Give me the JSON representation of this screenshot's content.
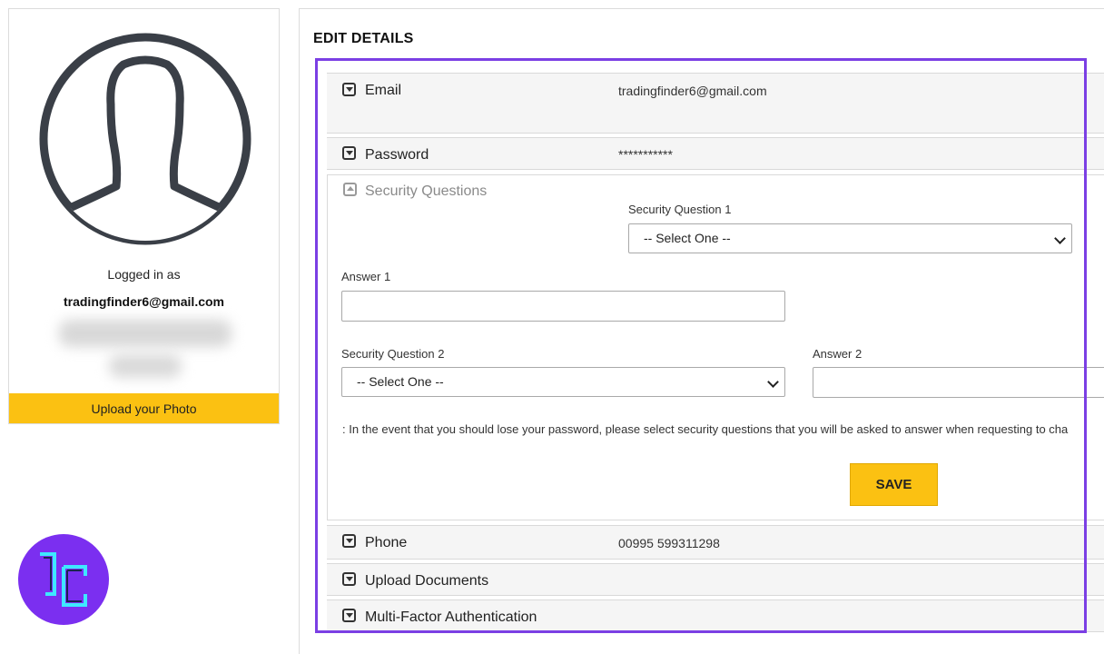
{
  "profile": {
    "logged_in_label": "Logged in as",
    "email": "tradingfinder6@gmail.com",
    "upload_photo_label": "Upload your Photo"
  },
  "edit": {
    "title": "EDIT DETAILS",
    "email_label": "Email",
    "email_value": "tradingfinder6@gmail.com",
    "password_label": "Password",
    "password_value": "***********",
    "security": {
      "title": "Security Questions",
      "question1_label": "Security Question 1",
      "question1_value": "-- Select One --",
      "answer1_label": "Answer 1",
      "question2_label": "Security Question 2",
      "question2_value": "-- Select One --",
      "answer2_label": "Answer 2",
      "note": ": In the event that you should lose your password, please select security questions that you will be asked to answer when requesting to cha",
      "save_label": "SAVE"
    },
    "phone_label": "Phone",
    "phone_value": "00995 599311298",
    "upload_documents_label": "Upload Documents",
    "mfa_label": "Multi-Factor Authentication"
  },
  "colors": {
    "accent_yellow": "#fbc112",
    "highlight_purple": "#7b3fe4",
    "logo_purple": "#7b2ff0",
    "logo_cyan": "#3ee8ff"
  }
}
